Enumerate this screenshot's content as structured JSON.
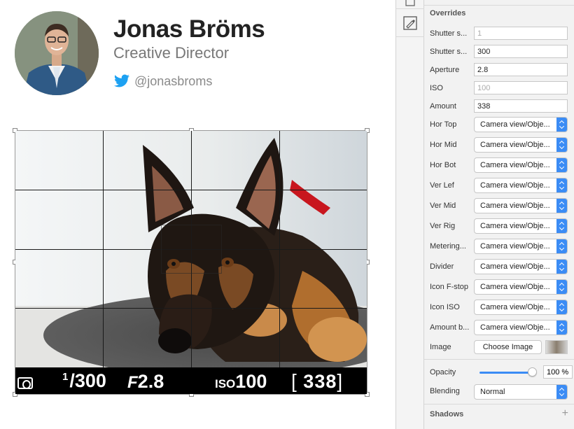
{
  "profile": {
    "name": "Jonas Bröms",
    "role": "Creative Director",
    "twitter_handle": "@jonasbroms"
  },
  "camera_overlay": {
    "shutter_numerator": "1",
    "shutter_denominator": "/300",
    "aperture_prefix": "F",
    "aperture": "2.8",
    "iso_prefix": "ISO",
    "iso": "100",
    "amount": "338",
    "amount_open": "[",
    "amount_close": "]"
  },
  "inspector": {
    "overrides_title": "Overrides",
    "fields": [
      {
        "label": "Shutter s...",
        "value": "1",
        "placeholder": true
      },
      {
        "label": "Shutter s...",
        "value": "300",
        "placeholder": false
      },
      {
        "label": "Aperture",
        "value": "2.8",
        "placeholder": false
      },
      {
        "label": "ISO",
        "value": "100",
        "placeholder": true
      },
      {
        "label": "Amount",
        "value": "338",
        "placeholder": false
      }
    ],
    "selects": [
      {
        "label": "Hor Top",
        "value": "Camera view/Obje..."
      },
      {
        "label": "Hor Mid",
        "value": "Camera view/Obje..."
      },
      {
        "label": "Hor Bot",
        "value": "Camera view/Obje..."
      },
      {
        "label": "Ver Lef",
        "value": "Camera view/Obje..."
      },
      {
        "label": "Ver Mid",
        "value": "Camera view/Obje..."
      },
      {
        "label": "Ver Rig",
        "value": "Camera view/Obje..."
      },
      {
        "label": "Metering...",
        "value": "Camera view/Obje..."
      },
      {
        "label": "Divider",
        "value": "Camera view/Obje..."
      },
      {
        "label": "Icon F-stop",
        "value": "Camera view/Obje..."
      },
      {
        "label": "Icon ISO",
        "value": "Camera view/Obje..."
      },
      {
        "label": "Amount b...",
        "value": "Camera view/Obje..."
      }
    ],
    "image_label": "Image",
    "choose_image": "Choose Image",
    "opacity_label": "Opacity",
    "opacity_value": "100 %",
    "opacity_level": 1.0,
    "blending_label": "Blending",
    "blending_value": "Normal",
    "shadows_title": "Shadows",
    "add_symbol": "+"
  },
  "colors": {
    "accent": "#3b8cf5",
    "twitter": "#1da1f2",
    "meter_bar": "#000000"
  }
}
